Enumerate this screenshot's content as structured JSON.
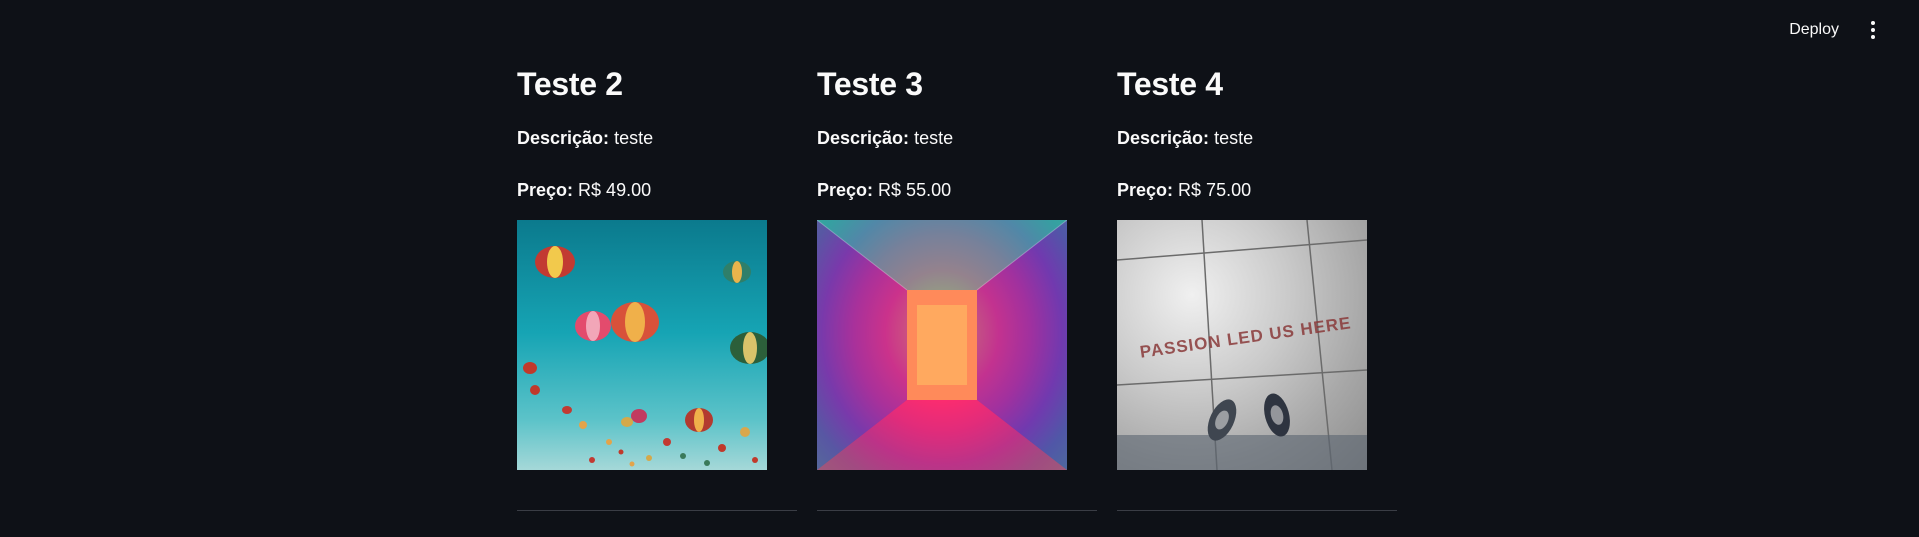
{
  "header": {
    "deploy_label": "Deploy",
    "menu_icon": "more-vertical-icon"
  },
  "products": [
    {
      "title": "Teste 2",
      "description_label": "Descrição:",
      "description": "teste",
      "price_label": "Preço:",
      "price": "R$ 49.00",
      "image_alt": "hot air balloons in a blue sky"
    },
    {
      "title": "Teste 3",
      "description_label": "Descrição:",
      "description": "teste",
      "price_label": "Preço:",
      "price": "R$ 55.00",
      "image_alt": "neon lit corridor"
    },
    {
      "title": "Teste 4",
      "description_label": "Descrição:",
      "description": "teste",
      "price_label": "Preço:",
      "price": "R$ 75.00",
      "image_alt": "pavement with painted text",
      "image_text": "PASSION LED US HERE"
    }
  ],
  "colors": {
    "background": "#0e1117",
    "text": "#fafafa",
    "divider": "#3a3d45"
  }
}
